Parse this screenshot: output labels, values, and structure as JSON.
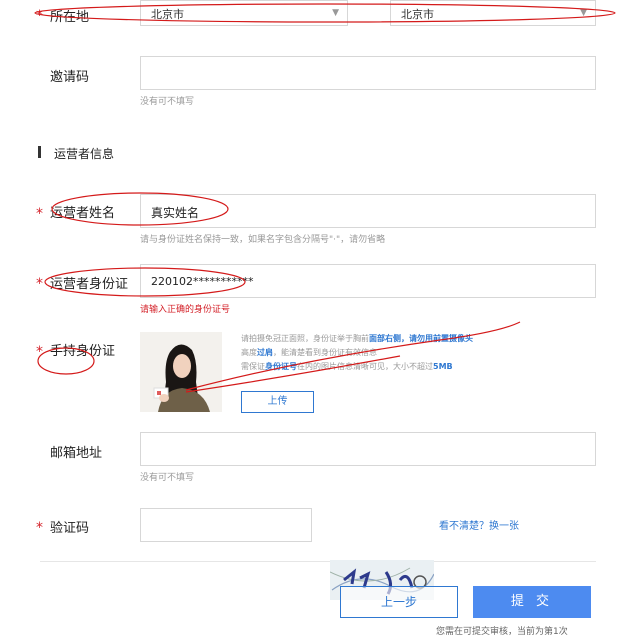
{
  "location": {
    "label": "所在地",
    "province": "北京市",
    "city": "北京市"
  },
  "invite": {
    "label": "邀请码",
    "value": "",
    "hint": "没有可不填写"
  },
  "section": {
    "title": "运营者信息"
  },
  "operator_name": {
    "label": "运营者姓名",
    "value": "真实姓名",
    "hint": "请与身份证姓名保持一致，如果名字包含分隔号\"·\"，请勿省略"
  },
  "operator_id": {
    "label": "运营者身份证",
    "value": "220102***********",
    "error": "请输入正确的身份证号"
  },
  "hold_id": {
    "label": "手持身份证",
    "guide_line1_prefix": "请拍摄免冠正面照，身份证举于胸前",
    "guide_line1_highlight": "面部右侧，请勿用前置摄像头",
    "guide_line2_prefix": "高度",
    "guide_line2_highlight": "过肩",
    "guide_line2_suffix": "，能清楚看到身份证有效信息",
    "guide_line3_prefix": "需保证",
    "guide_line3_highlight": "身份证号",
    "guide_line3_middle": "在内的图片信息清晰可见，大小不超过",
    "guide_line3_size": "5MB",
    "upload_label": "上传"
  },
  "email": {
    "label": "邮箱地址",
    "value": "",
    "hint": "没有可不填写"
  },
  "captcha": {
    "label": "验证码",
    "value": "",
    "refresh_link": "看不清楚？换一张"
  },
  "actions": {
    "prev_label": "上一步",
    "submit_label": "提 交",
    "footer_note": "您需在可提交审核，当前为第1次"
  },
  "colors": {
    "required": "#d4222a",
    "link": "#2f78d1",
    "submit": "#4d8bf0",
    "annotation": "#d41a1a"
  }
}
